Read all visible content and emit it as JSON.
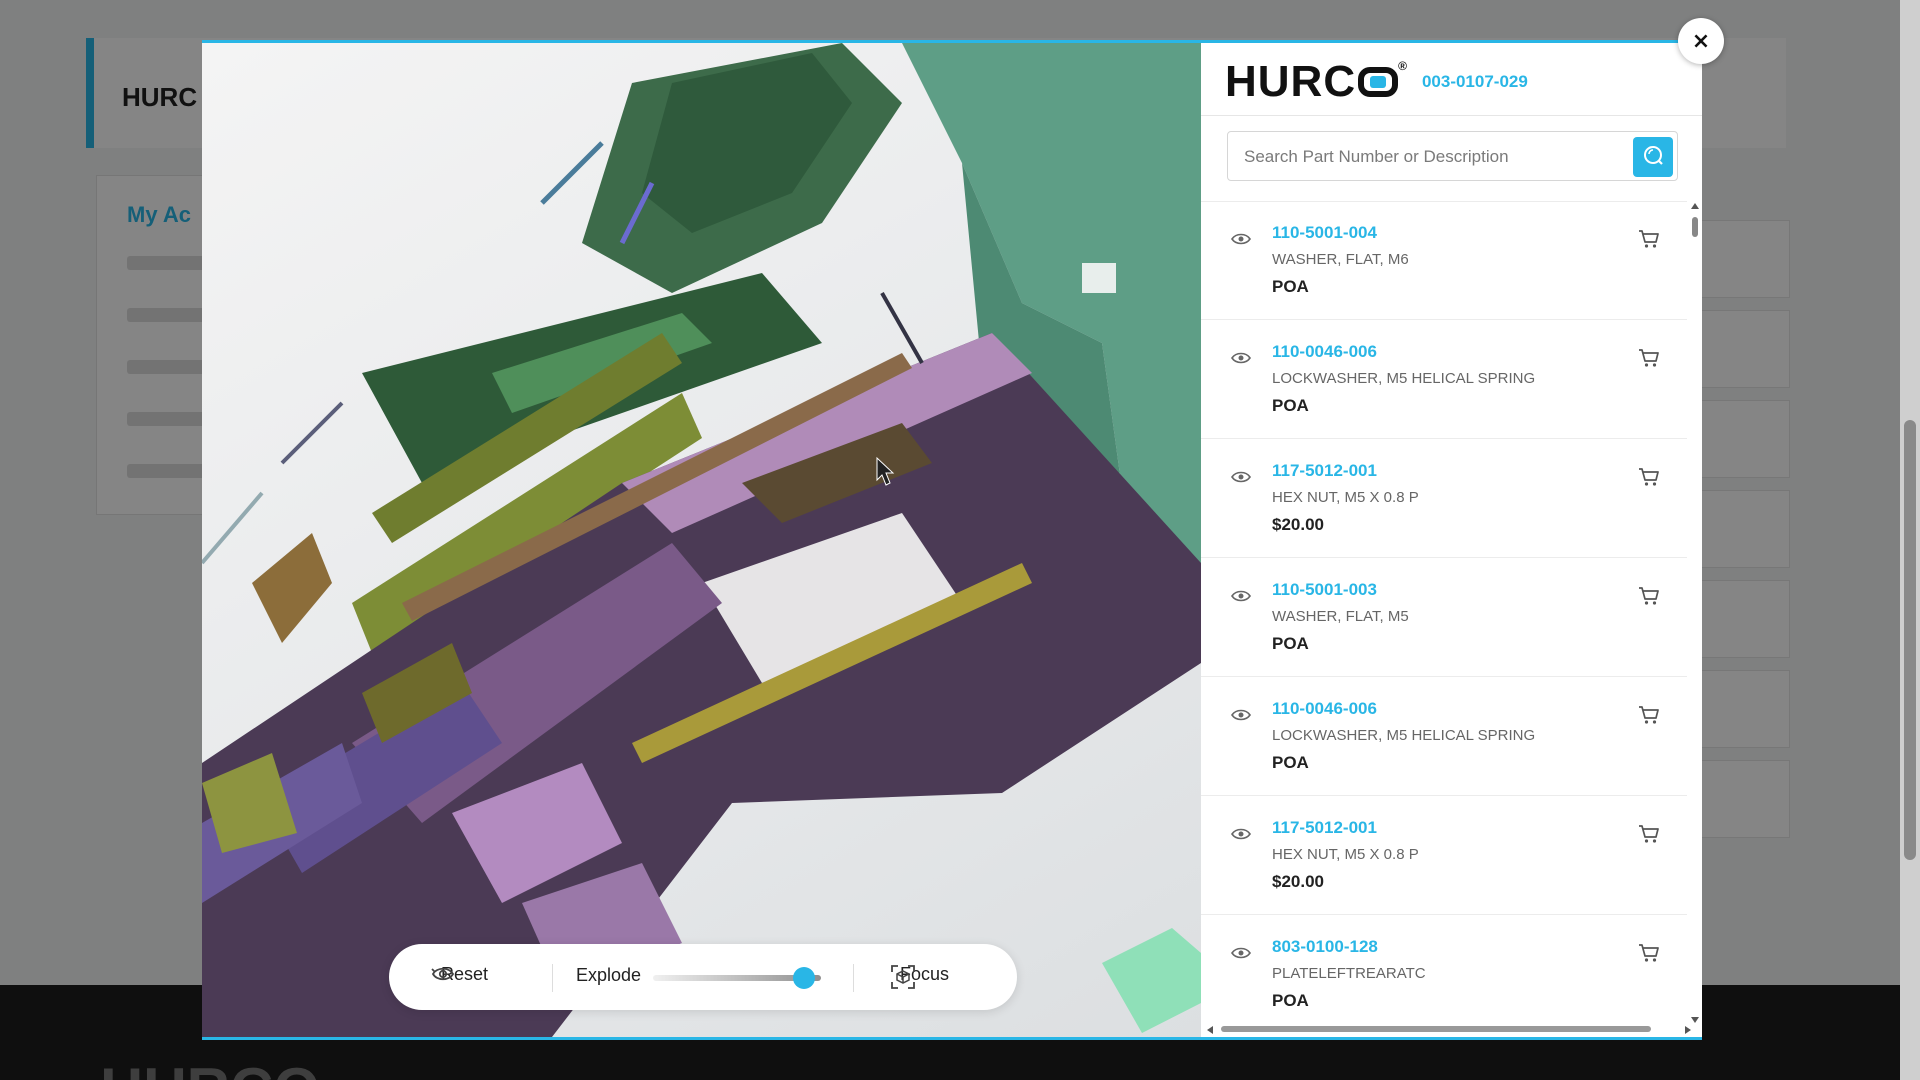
{
  "background": {
    "logo_text": "HURC",
    "sidebar_title": "My Ac",
    "footer_logo": "HURCO"
  },
  "modal": {
    "close_label": "×",
    "viewer": {
      "toolbar": {
        "reset_label": "Reset",
        "explode_label": "Explode",
        "explode_level": 0.9,
        "focus_label": "Focus"
      }
    },
    "panel": {
      "brand": "HURC",
      "brand_reg": "®",
      "part_code": "003-0107-029",
      "search": {
        "placeholder": "Search Part Number or Description",
        "value": ""
      },
      "items": [
        {
          "part_number": "110-5001-004",
          "description": "WASHER, FLAT, M6",
          "price": "POA"
        },
        {
          "part_number": "110-0046-006",
          "description": "LOCKWASHER, M5 HELICAL SPRING",
          "price": "POA"
        },
        {
          "part_number": "117-5012-001",
          "description": "HEX NUT, M5 X 0.8 P",
          "price": "$20.00"
        },
        {
          "part_number": "110-5001-003",
          "description": "WASHER, FLAT, M5",
          "price": "POA"
        },
        {
          "part_number": "110-0046-006",
          "description": "LOCKWASHER, M5 HELICAL SPRING",
          "price": "POA"
        },
        {
          "part_number": "117-5012-001",
          "description": "HEX NUT, M5 X 0.8 P",
          "price": "$20.00"
        },
        {
          "part_number": "803-0100-128",
          "description": "PLATELEFTREARATC",
          "price": "POA"
        }
      ]
    }
  },
  "colors": {
    "accent": "#29b6e6",
    "text": "#222222",
    "muted": "#666666"
  },
  "icons": {
    "reset": "eye-icon",
    "focus": "focus-cube-icon",
    "search": "search-icon",
    "item_view": "eye-icon",
    "item_cart": "cart-icon",
    "close": "close-icon"
  }
}
